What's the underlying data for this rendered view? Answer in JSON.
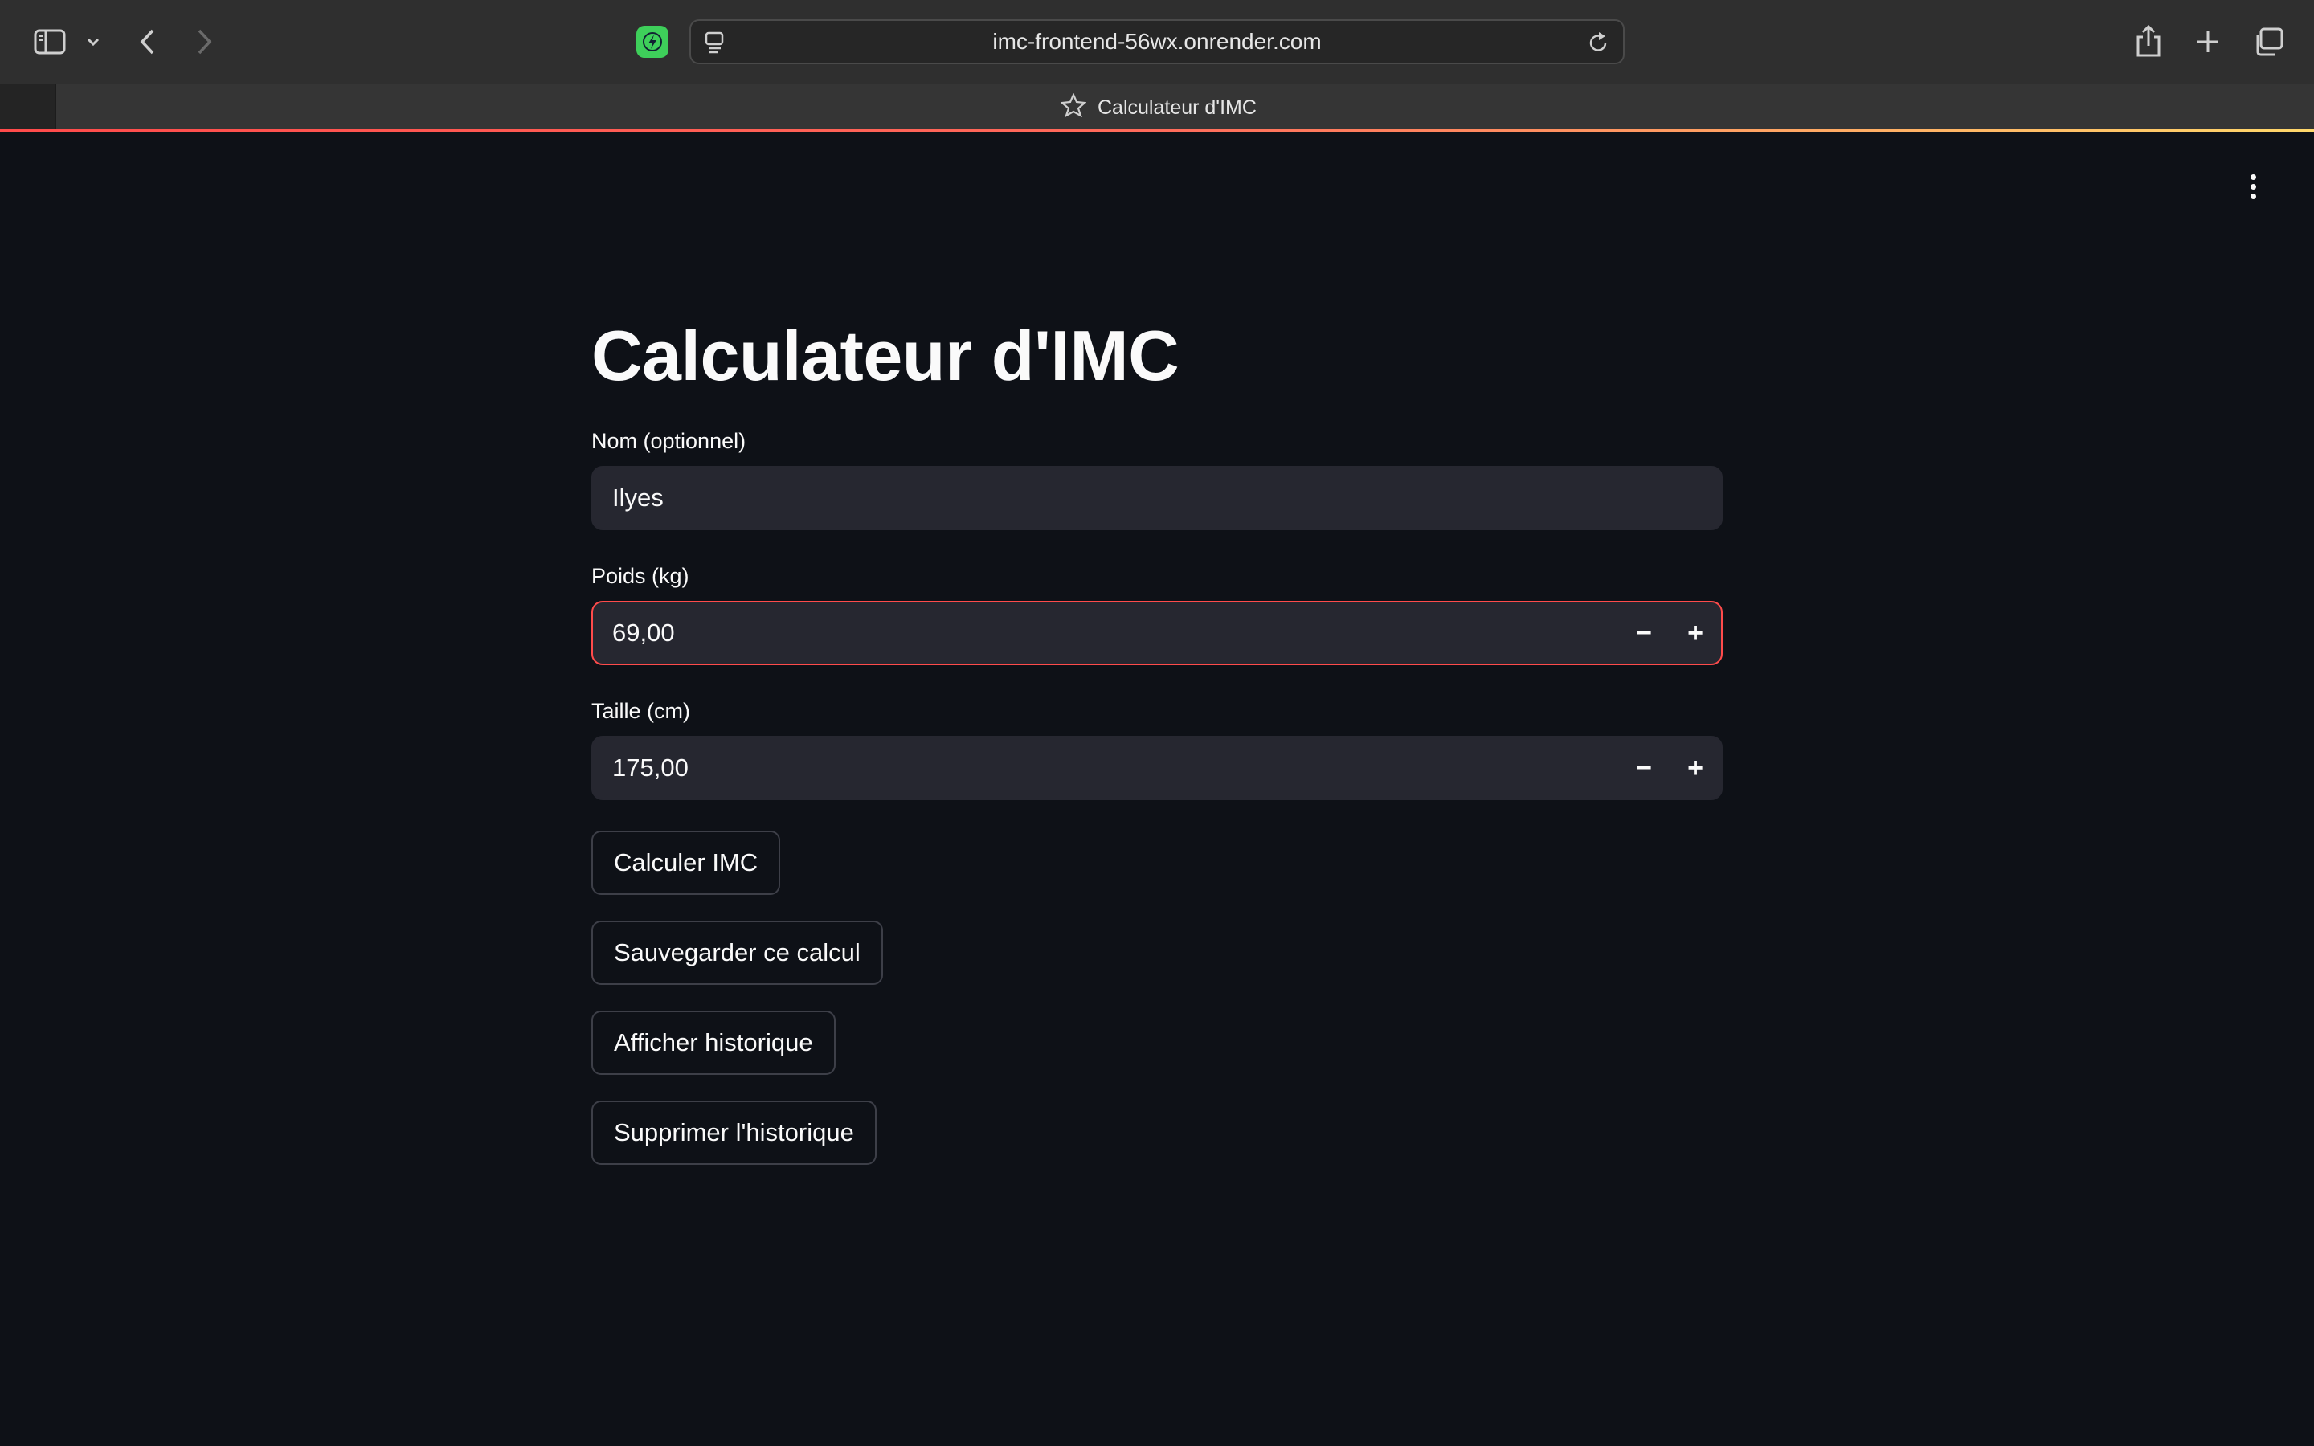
{
  "browser": {
    "url": "imc-frontend-56wx.onrender.com",
    "tab_title": "Calculateur d'IMC",
    "icons": [
      "sidebar-icon",
      "chevron-down-icon",
      "back-icon",
      "forward-icon",
      "extension-icon",
      "page-icon",
      "reload-icon",
      "share-icon",
      "new-tab-icon",
      "tabs-overview-icon",
      "star-icon"
    ]
  },
  "app": {
    "title": "Calculateur d'IMC",
    "fields": {
      "nom": {
        "label": "Nom (optionnel)",
        "value": "Ilyes"
      },
      "poids": {
        "label": "Poids (kg)",
        "value": "69,00",
        "decrement": "−",
        "increment": "+"
      },
      "taille": {
        "label": "Taille (cm)",
        "value": "175,00",
        "decrement": "−",
        "increment": "+"
      }
    },
    "buttons": {
      "calculer": "Calculer IMC",
      "sauvegarder": "Sauvegarder ce calcul",
      "afficher": "Afficher historique",
      "supprimer": "Supprimer l'historique"
    },
    "colors": {
      "background": "#0e1117",
      "input_bg": "#262730",
      "accent": "#ff4b4b"
    }
  }
}
